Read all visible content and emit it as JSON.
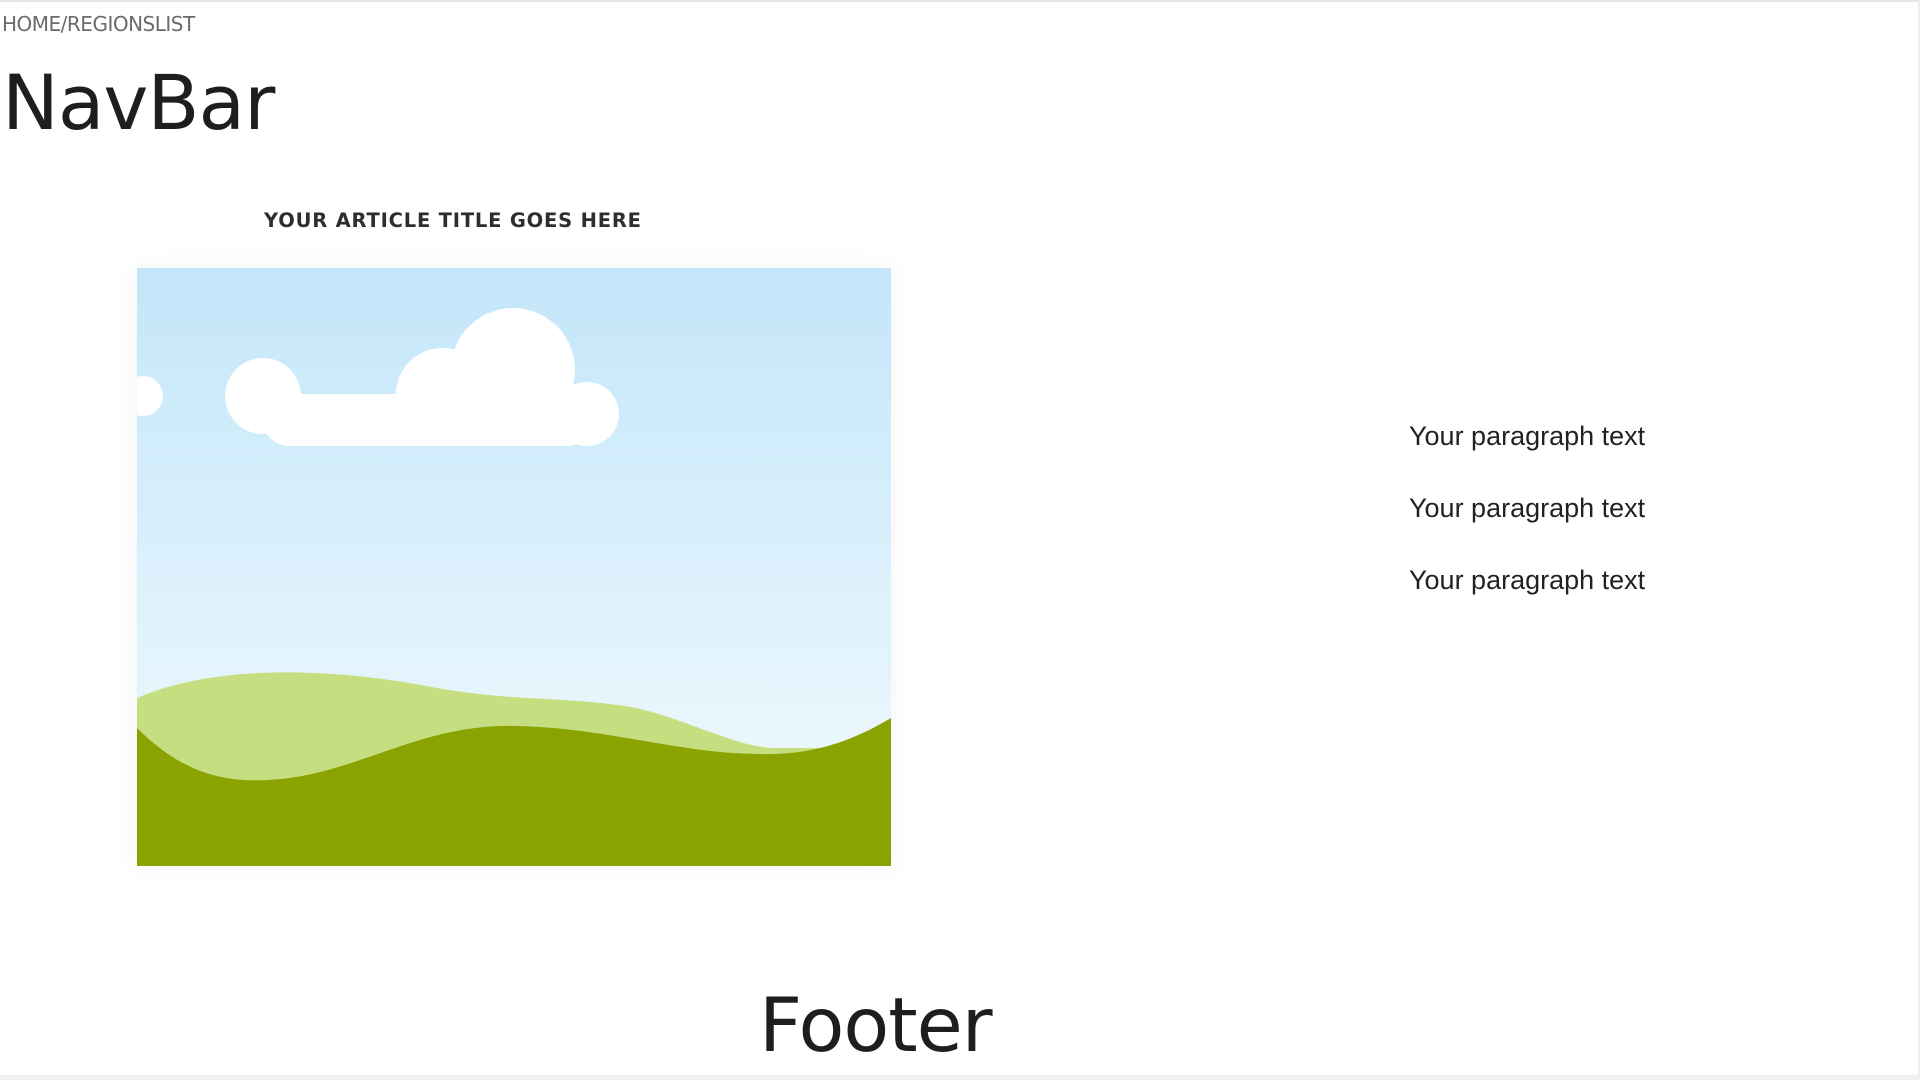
{
  "breadcrumb": {
    "text": "HOME/REGIONSLIST"
  },
  "header": {
    "title": "NavBar"
  },
  "article": {
    "title": "YOUR ARTICLE TITLE GOES HERE",
    "image_icon": "landscape-placeholder-icon",
    "colors": {
      "sky_top": "#c3e6fa",
      "sky_bottom": "#f3fbfd",
      "hill_back": "#c5df80",
      "hill_front": "#8aa300",
      "cloud": "#ffffff"
    }
  },
  "content": {
    "paragraphs": [
      "Your paragraph text",
      "Your paragraph text",
      "Your paragraph text"
    ]
  },
  "footer": {
    "title": "Footer"
  }
}
